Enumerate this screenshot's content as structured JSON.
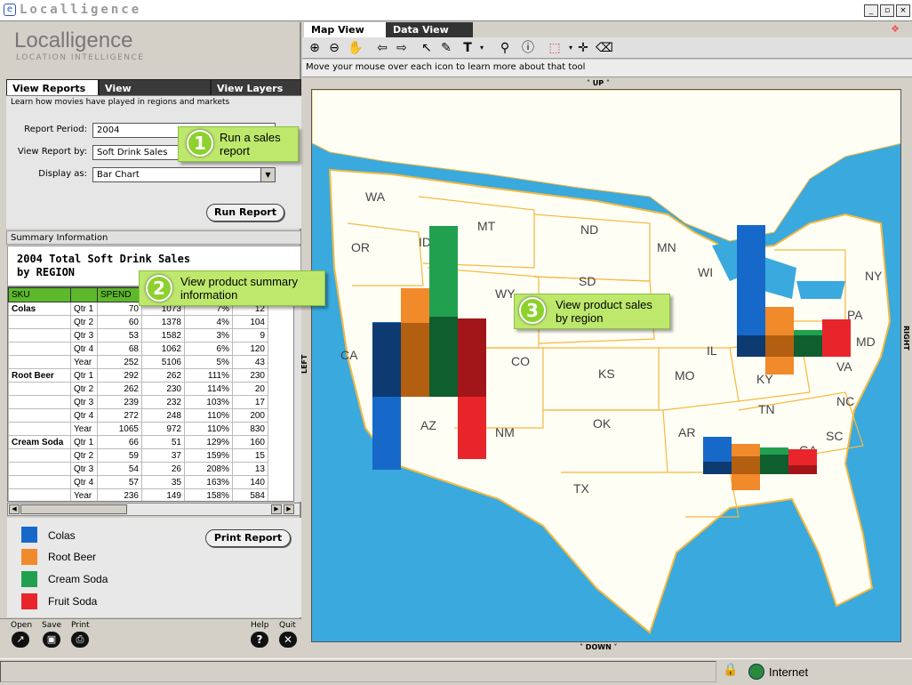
{
  "window": {
    "title": "Localligence"
  },
  "app": {
    "logo": "Localligence",
    "logo_sub": "LOCATION INTELLIGENCE"
  },
  "left_tabs": [
    {
      "label": "View Reports"
    },
    {
      "label": "View Demographics"
    },
    {
      "label": "View Layers"
    }
  ],
  "tab_desc": "Learn how movies have played in regions and markets",
  "form": {
    "period_label": "Report Period:",
    "period_value": "2004",
    "reportby_label": "View Report by:",
    "reportby_value": "Soft Drink Sales",
    "display_label": "Display as:",
    "display_value": "Bar Chart",
    "run_button": "Run Report"
  },
  "summary": {
    "header": "Summary Information",
    "title_line1": "2004 Total Soft Drink Sales",
    "title_line2": "by REGION",
    "columns": [
      "SKU",
      "",
      "SPEND",
      "",
      "",
      ""
    ],
    "rows": [
      [
        "Colas",
        "Qtr 1",
        "70",
        "1073",
        "7%",
        "12"
      ],
      [
        "",
        "Qtr 2",
        "60",
        "1378",
        "4%",
        "104"
      ],
      [
        "",
        "Qtr 3",
        "53",
        "1582",
        "3%",
        "9"
      ],
      [
        "",
        "Qtr 4",
        "68",
        "1062",
        "6%",
        "120"
      ],
      [
        "",
        "Year",
        "252",
        "5106",
        "5%",
        "43"
      ],
      [
        "Root Beer",
        "Qtr 1",
        "292",
        "262",
        "111%",
        "230"
      ],
      [
        "",
        "Qtr 2",
        "262",
        "230",
        "114%",
        "20"
      ],
      [
        "",
        "Qtr 3",
        "239",
        "232",
        "103%",
        "17"
      ],
      [
        "",
        "Qtr 4",
        "272",
        "248",
        "110%",
        "200"
      ],
      [
        "",
        "Year",
        "1065",
        "972",
        "110%",
        "830"
      ],
      [
        "Cream Soda",
        "Qtr 1",
        "66",
        "51",
        "129%",
        "160"
      ],
      [
        "",
        "Qtr 2",
        "59",
        "37",
        "159%",
        "15"
      ],
      [
        "",
        "Qtr 3",
        "54",
        "26",
        "208%",
        "13"
      ],
      [
        "",
        "Qtr 4",
        "57",
        "35",
        "163%",
        "140"
      ],
      [
        "",
        "Year",
        "236",
        "149",
        "158%",
        "584"
      ]
    ],
    "print_button": "Print Report"
  },
  "legend": [
    {
      "label": "Colas",
      "color": "#1769c9"
    },
    {
      "label": "Root Beer",
      "color": "#f08a2a"
    },
    {
      "label": "Cream Soda",
      "color": "#21a150"
    },
    {
      "label": "Fruit Soda",
      "color": "#e8252b"
    }
  ],
  "bottom_tools": {
    "open": "Open",
    "save": "Save",
    "print": "Print",
    "help": "Help",
    "quit": "Quit"
  },
  "callouts": [
    {
      "num": "1",
      "text1": "Run a sales",
      "text2": "report"
    },
    {
      "num": "2",
      "text1": "View product summary",
      "text2": "information"
    },
    {
      "num": "3",
      "text1": "View product sales",
      "text2": "by region"
    }
  ],
  "map_tabs": [
    {
      "label": "Map View"
    },
    {
      "label": "Data View"
    }
  ],
  "map_hint": "Move your mouse over each icon to learn more about that tool",
  "nav": {
    "up": "UP",
    "down": "DOWN",
    "left": "LEFT",
    "right": "RIGHT"
  },
  "states": [
    "WA",
    "MT",
    "ND",
    "OR",
    "ID",
    "SD",
    "MN",
    "WI",
    "NY",
    "WY",
    "CA",
    "CO",
    "KS",
    "MO",
    "IL",
    "PA",
    "MD",
    "VA",
    "KY",
    "AZ",
    "NM",
    "OK",
    "TN",
    "NC",
    "AR",
    "SC",
    "TX",
    "GA"
  ],
  "map_chart_data": {
    "type": "bar",
    "series": [
      "Colas",
      "Root Beer",
      "Cream Soda",
      "Fruit Soda"
    ]
  },
  "status": {
    "zone": "Internet"
  }
}
